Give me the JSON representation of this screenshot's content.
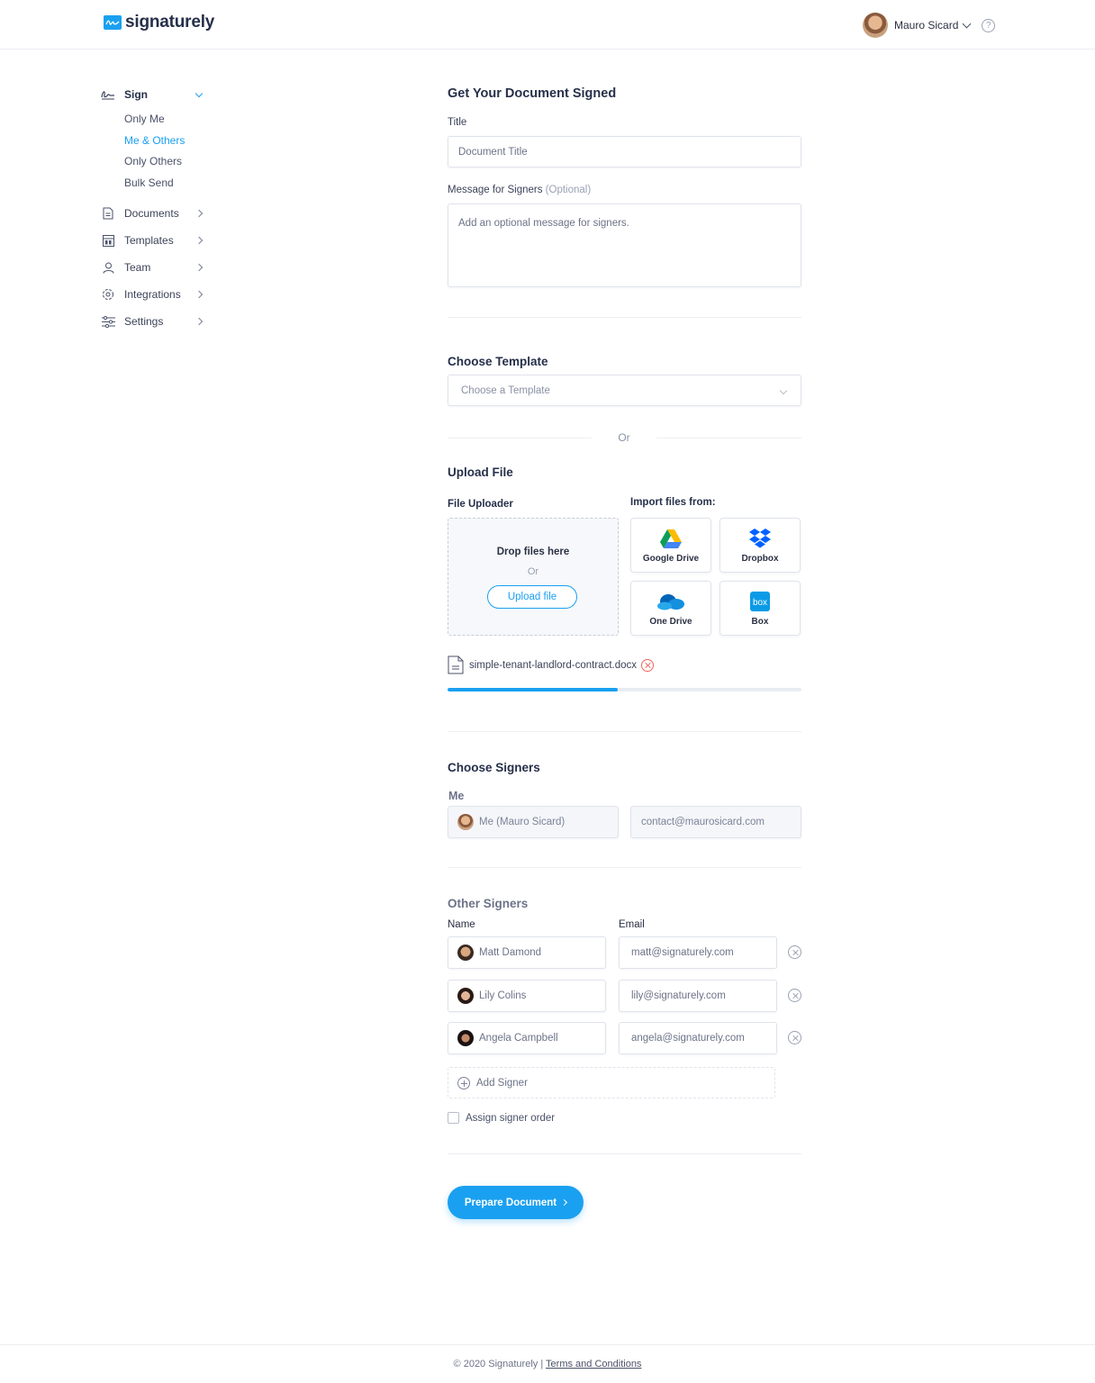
{
  "header": {
    "logo_text": "signaturely",
    "user_name": "Mauro Sicard",
    "help_glyph": "?"
  },
  "sidebar": {
    "sign": {
      "label": "Sign",
      "icon": "signature-icon",
      "sub_items": [
        {
          "label": "Only Me",
          "active": false
        },
        {
          "label": "Me & Others",
          "active": true
        },
        {
          "label": "Only Others",
          "active": false
        },
        {
          "label": "Bulk Send",
          "active": false
        }
      ]
    },
    "items": [
      {
        "label": "Documents",
        "icon": "document-icon"
      },
      {
        "label": "Templates",
        "icon": "template-icon"
      },
      {
        "label": "Team",
        "icon": "user-icon"
      },
      {
        "label": "Integrations",
        "icon": "integrations-icon"
      },
      {
        "label": "Settings",
        "icon": "sliders-icon"
      }
    ]
  },
  "form": {
    "heading": "Get Your Document Signed",
    "title_label": "Title",
    "title_placeholder": "Document Title",
    "message_label": "Message for Signers",
    "message_optional": "(Optional)",
    "message_placeholder": "Add an optional message for signers.",
    "template_heading": "Choose Template",
    "template_placeholder": "Choose a Template",
    "or_text": "Or",
    "upload_heading": "Upload File",
    "uploader_label": "File Uploader",
    "import_label": "Import files from:",
    "drop_title": "Drop files here",
    "drop_or": "Or",
    "upload_button": "Upload file",
    "import_sources": [
      {
        "name": "Google Drive",
        "icon": "google-drive-icon"
      },
      {
        "name": "Dropbox",
        "icon": "dropbox-icon"
      },
      {
        "name": "One Drive",
        "icon": "onedrive-icon"
      },
      {
        "name": "Box",
        "icon": "box-icon"
      }
    ],
    "uploaded_file": "simple-tenant-landlord-contract.docx",
    "upload_progress": 0.48,
    "signers_heading": "Choose Signers",
    "me_label": "Me",
    "me_name": "Me (Mauro Sicard)",
    "me_email": "contact@maurosicard.com",
    "other_signers_heading": "Other Signers",
    "name_col": "Name",
    "email_col": "Email",
    "other_signers": [
      {
        "name": "Matt Damond",
        "email": "matt@signaturely.com"
      },
      {
        "name": "Lily Colins",
        "email": "lily@signaturely.com"
      },
      {
        "name": "Angela Campbell",
        "email": "angela@signaturely.com"
      }
    ],
    "add_signer": "Add Signer",
    "assign_order": "Assign signer order",
    "prepare_button": "Prepare Document"
  },
  "footer": {
    "copyright": "© 2020 Signaturely |",
    "terms_link": "Terms and Conditions"
  },
  "colors": {
    "accent": "#1aa0f0",
    "danger": "#f0645a",
    "text": "#2b3043"
  }
}
